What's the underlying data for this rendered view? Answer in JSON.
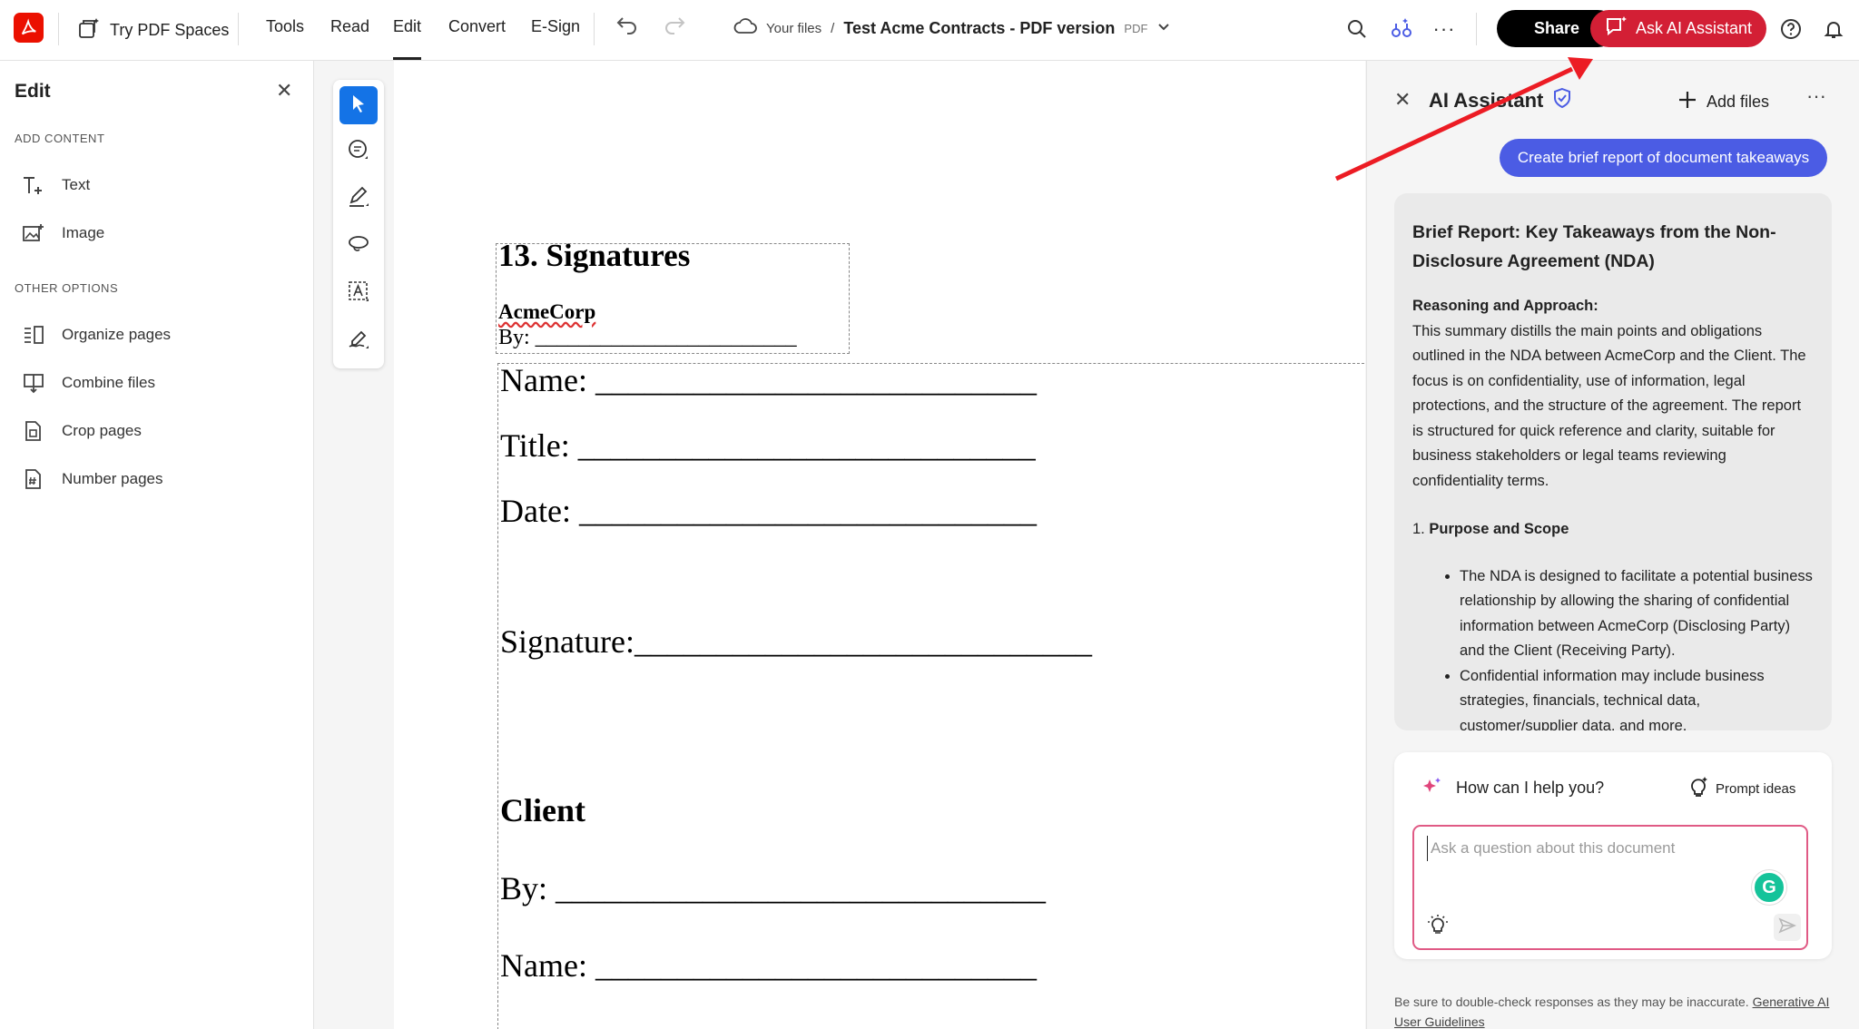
{
  "topbar": {
    "try_pdf_spaces": "Try PDF Spaces",
    "tabs": [
      {
        "label": "Tools"
      },
      {
        "label": "Read"
      },
      {
        "label": "Edit"
      },
      {
        "label": "Convert"
      },
      {
        "label": "E-Sign"
      }
    ],
    "active_tab": "Edit",
    "breadcrumb_root": "Your files",
    "breadcrumb_sep": "/",
    "doc_title": "Test Acme Contracts - PDF version",
    "doc_type": "PDF",
    "share_label": "Share",
    "ask_ai_label": "Ask AI Assistant",
    "colors": {
      "share_bg": "#000000",
      "ask_ai_bg": "#d31f35",
      "logo_bg": "#eb1000"
    }
  },
  "left_panel": {
    "title": "Edit",
    "add_content_heading": "ADD CONTENT",
    "add_content_items": [
      {
        "label": "Text",
        "icon": "add-text-icon"
      },
      {
        "label": "Image",
        "icon": "add-image-icon"
      }
    ],
    "other_options_heading": "OTHER OPTIONS",
    "other_items": [
      {
        "label": "Organize pages",
        "icon": "organize-pages-icon"
      },
      {
        "label": "Combine files",
        "icon": "combine-files-icon"
      },
      {
        "label": "Crop pages",
        "icon": "crop-pages-icon"
      },
      {
        "label": "Number pages",
        "icon": "number-pages-icon"
      }
    ]
  },
  "document": {
    "section_heading": "13. Signatures",
    "company": "AcmeCorp",
    "by_line": "By: ________________________",
    "name_line": "Name: ___________________________",
    "title_line": "Title: ____________________________",
    "date_line": "Date: ____________________________",
    "signature_line": "Signature:____________________________",
    "client_heading": "Client",
    "client_by_line": "By: ______________________________",
    "client_name_line": "Name: ___________________________"
  },
  "ai_panel": {
    "title": "AI Assistant",
    "add_files_label": "Add files",
    "prompt_chip": "Create brief report of document takeaways",
    "response": {
      "title": "Brief Report: Key Takeaways from the Non-Disclosure Agreement (NDA)",
      "reasoning_heading": "Reasoning and Approach:",
      "reasoning_text": "This summary distills the main points and obligations outlined in the NDA between AcmeCorp and the Client. The focus is on confidentiality, use of information, legal protections, and the structure of the agreement. The report is structured for quick reference and clarity, suitable for business stakeholders or legal teams reviewing confidentiality terms.",
      "section1_number": "1.",
      "section1_title": "Purpose and Scope",
      "bullets": [
        "The NDA is designed to facilitate a potential business relationship by allowing the sharing of confidential information between AcmeCorp (Disclosing Party) and the Client (Receiving Party).",
        "Confidential information may include business strategies, financials, technical data, customer/supplier data, and more."
      ]
    },
    "help_prompt": "How can I help you?",
    "prompt_ideas_label": "Prompt ideas",
    "input_placeholder": "Ask a question about this document",
    "disclaimer_text": "Be sure to double-check responses as they may be inaccurate.",
    "disclaimer_link": "Generative AI User Guidelines",
    "colors": {
      "chip_bg": "#4b5ce4",
      "input_border": "#e05a85"
    }
  }
}
